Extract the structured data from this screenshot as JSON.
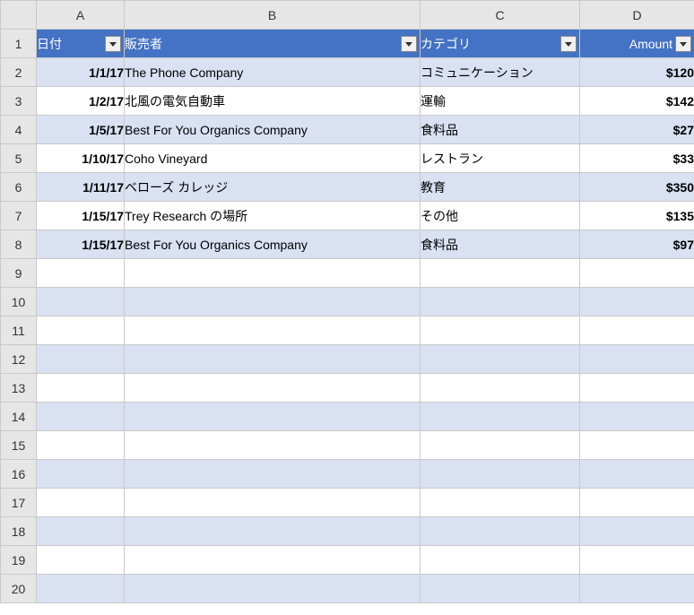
{
  "columns": [
    "A",
    "B",
    "C",
    "D"
  ],
  "row_count": 20,
  "headers": {
    "A": "日付",
    "B": "販売者",
    "C": "カテゴリ",
    "D": "Amount"
  },
  "rows": [
    {
      "date": "1/1/17",
      "vendor": "The Phone Company",
      "category": "コミュニケーション",
      "amount": "$120"
    },
    {
      "date": "1/2/17",
      "vendor": "北風の電気自動車",
      "category": "運輸",
      "amount": "$142"
    },
    {
      "date": "1/5/17",
      "vendor": "Best For You Organics Company",
      "category": "食料品",
      "amount": "$27"
    },
    {
      "date": "1/10/17",
      "vendor": "Coho Vineyard",
      "category": "レストラン",
      "amount": "$33"
    },
    {
      "date": "1/11/17",
      "vendor": "ベローズ カレッジ",
      "category": "教育",
      "amount": "$350"
    },
    {
      "date": "1/15/17",
      "vendor": "Trey Research の場所",
      "category": "その他",
      "amount": "$135"
    },
    {
      "date": "1/15/17",
      "vendor": "Best For You Organics Company",
      "category": "食料品",
      "amount": "$97"
    }
  ],
  "chart_data": {
    "type": "table",
    "columns": [
      "日付",
      "販売者",
      "カテゴリ",
      "Amount"
    ],
    "data": [
      [
        "1/1/17",
        "The Phone Company",
        "コミュニケーション",
        "$120"
      ],
      [
        "1/2/17",
        "北風の電気自動車",
        "運輸",
        "$142"
      ],
      [
        "1/5/17",
        "Best For You Organics Company",
        "食料品",
        "$27"
      ],
      [
        "1/10/17",
        "Coho Vineyard",
        "レストラン",
        "$33"
      ],
      [
        "1/11/17",
        "ベローズ カレッジ",
        "教育",
        "$350"
      ],
      [
        "1/15/17",
        "Trey Research の場所",
        "その他",
        "$135"
      ],
      [
        "1/15/17",
        "Best For You Organics Company",
        "食料品",
        "$97"
      ]
    ]
  }
}
